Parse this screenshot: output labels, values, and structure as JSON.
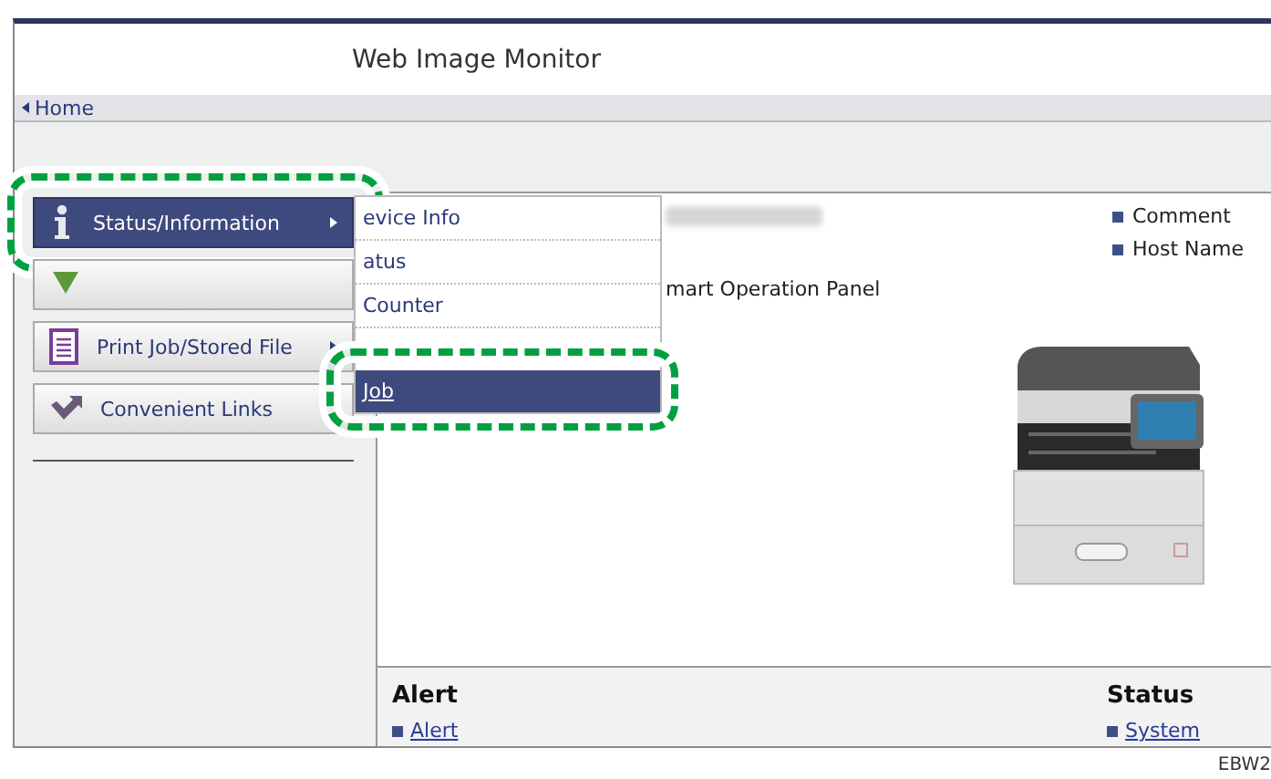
{
  "window": {
    "title": "Web Image Monitor"
  },
  "breadcrumb": {
    "label": "Home"
  },
  "side_menu": [
    {
      "kind": "info",
      "label": "Status/Information",
      "has_submenu": true,
      "selected": true,
      "highlighted": true
    },
    {
      "kind": "download",
      "has_submenu": false,
      "selected": false,
      "highlighted": false
    },
    {
      "kind": "document",
      "label": "Print Job/Stored File",
      "has_submenu": true,
      "selected": false,
      "highlighted": false
    },
    {
      "kind": "link",
      "label": "Convenient Links",
      "has_submenu": false,
      "selected": false,
      "highlighted": false
    }
  ],
  "submenu": [
    {
      "label": "evice Info",
      "selected": false,
      "highlighted": false
    },
    {
      "label": "atus",
      "selected": false,
      "highlighted": false
    },
    {
      "label": "Counter",
      "selected": false,
      "highlighted": false
    },
    {
      "label": "Job",
      "selected": true,
      "highlighted": true
    }
  ],
  "device": {
    "model": "mart Operation Panel",
    "links": [
      "Comment",
      "Host Name"
    ]
  },
  "alert": {
    "heading": "Alert",
    "links": [
      "Alert"
    ]
  },
  "status": {
    "heading": "Status",
    "links": [
      "System"
    ]
  },
  "figure_code": "EBW2"
}
